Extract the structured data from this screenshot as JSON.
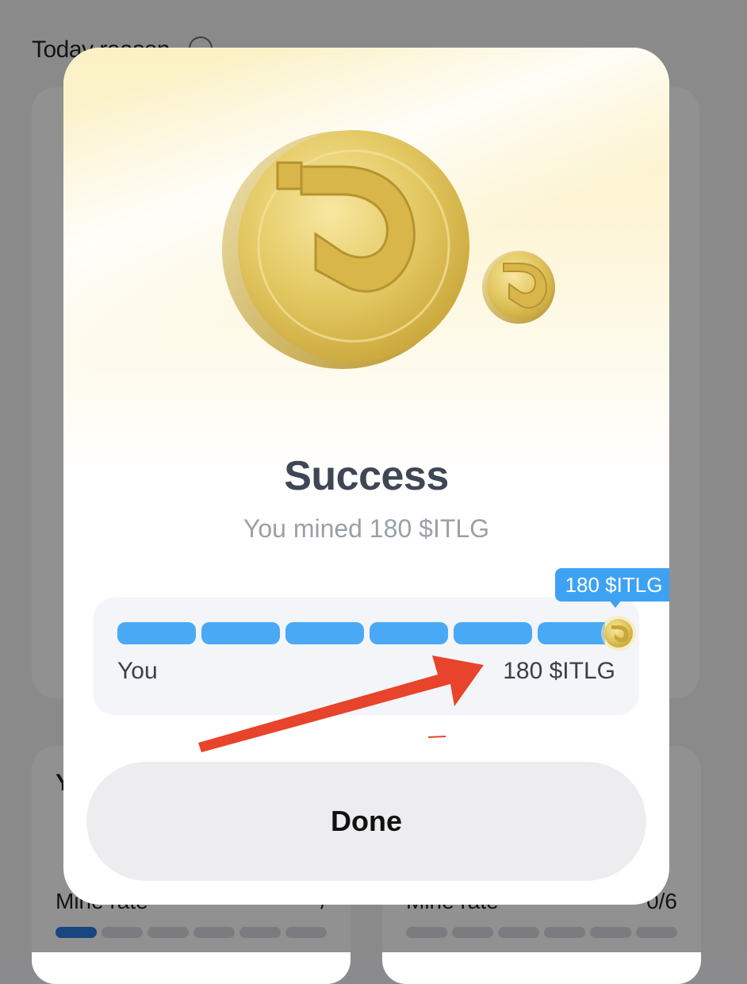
{
  "background": {
    "title": "Today reason",
    "cards": [
      {
        "heading": "Y",
        "label": "Mine rate",
        "count": "/"
      },
      {
        "heading": "",
        "label": "Mine rate",
        "count": "0/6"
      }
    ],
    "mini_progress": {
      "filled": 1,
      "total": 6
    }
  },
  "modal": {
    "title": "Success",
    "subtitle": "You mined 180 $ITLG",
    "tooltip": "180 $ITLG",
    "progress": {
      "segments_total": 6,
      "segments_filled": 6,
      "left_label": "You",
      "right_label": "180 $ITLG"
    },
    "done_label": "Done"
  },
  "icons": {
    "hero_coin": "itlg-coin-icon",
    "small_coin": "itlg-coin-icon",
    "marker": "itlg-coin-icon",
    "annotation": "red-arrow"
  },
  "colors": {
    "accent": "#4aa9f4",
    "tooltip": "#3ea2f3",
    "arrow": "#e8432b",
    "coin": "#e2c35a"
  }
}
